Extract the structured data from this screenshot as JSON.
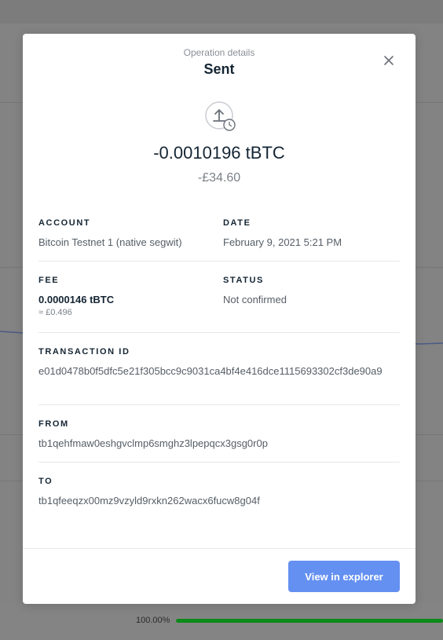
{
  "modal": {
    "subtitle": "Operation details",
    "title": "Sent",
    "amount": "-0.0010196 tBTC",
    "fiat": "-£34.60"
  },
  "fields": {
    "account_label": "ACCOUNT",
    "account_value": "Bitcoin Testnet 1 (native segwit)",
    "date_label": "DATE",
    "date_value": "February 9, 2021 5:21 PM",
    "fee_label": "FEE",
    "fee_value": "0.0000146 tBTC",
    "fee_fiat": "≈ £0.496",
    "status_label": "STATUS",
    "status_value": "Not confirmed",
    "txid_label": "TRANSACTION ID",
    "txid_value": "e01d0478b0f5dfc5e21f305bcc9c9031ca4bf4e416dce1115693302cf3de90a9",
    "from_label": "FROM",
    "from_value": "tb1qehfmaw0eshgvclmp6smghz3lpepqcx3gsg0r0p",
    "to_label": "TO",
    "to_value": "tb1qfeeqzx00mz9vzyld9rxkn262wacx6fucw8g04f"
  },
  "footer": {
    "explorer_button": "View in explorer"
  },
  "background": {
    "progress_text": "100.00%",
    "progress_fraction": 1.0
  },
  "colors": {
    "accent": "#6490f1",
    "progress": "#0c8a1a",
    "title": "#142533",
    "muted": "#7b8087"
  }
}
